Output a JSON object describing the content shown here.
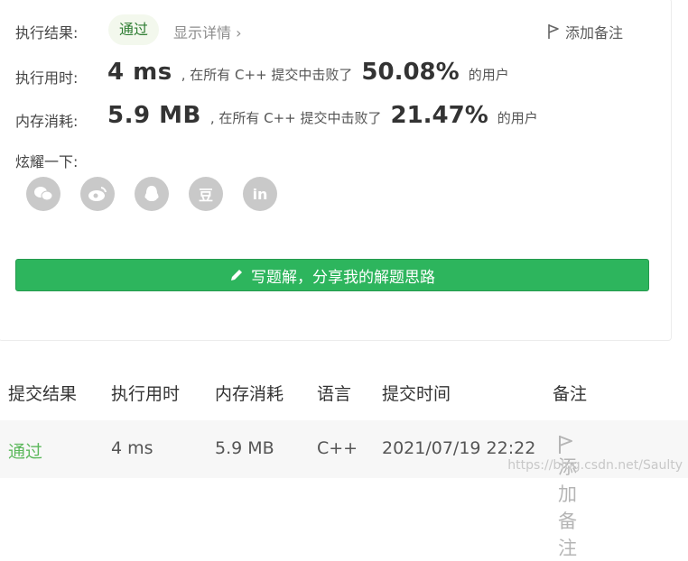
{
  "result": {
    "label": "执行结果:",
    "status": "通过",
    "detail_link": "显示详情 ›",
    "add_note": "添加备注"
  },
  "runtime": {
    "label": "执行用时:",
    "value": "4 ms",
    "mid_text": ", 在所有 C++ 提交中击败了",
    "percent": "50.08%",
    "tail": "的用户"
  },
  "memory": {
    "label": "内存消耗:",
    "value": "5.9 MB",
    "mid_text": ", 在所有 C++ 提交中击败了",
    "percent": "21.47%",
    "tail": "的用户"
  },
  "share": {
    "label": "炫耀一下:",
    "icons": [
      "wechat-icon",
      "weibo-icon",
      "qq-icon",
      "douban-icon",
      "linkedin-icon"
    ],
    "douban_glyph": "豆",
    "linkedin_glyph": "in"
  },
  "solution_button": "写题解，分享我的解题思路",
  "table": {
    "headers": [
      "提交结果",
      "执行用时",
      "内存消耗",
      "语言",
      "提交时间",
      "备注"
    ],
    "row": {
      "result": "通过",
      "runtime": "4 ms",
      "memory": "5.9 MB",
      "language": "C++",
      "time": "2021/07/19 22:22",
      "note": "添加备注"
    }
  },
  "watermark": "https://blog.csdn.net/Saulty",
  "colors": {
    "accent_green": "#2db55d",
    "pass_text": "#5cb85c",
    "icon_gray": "#c9c9c9"
  }
}
